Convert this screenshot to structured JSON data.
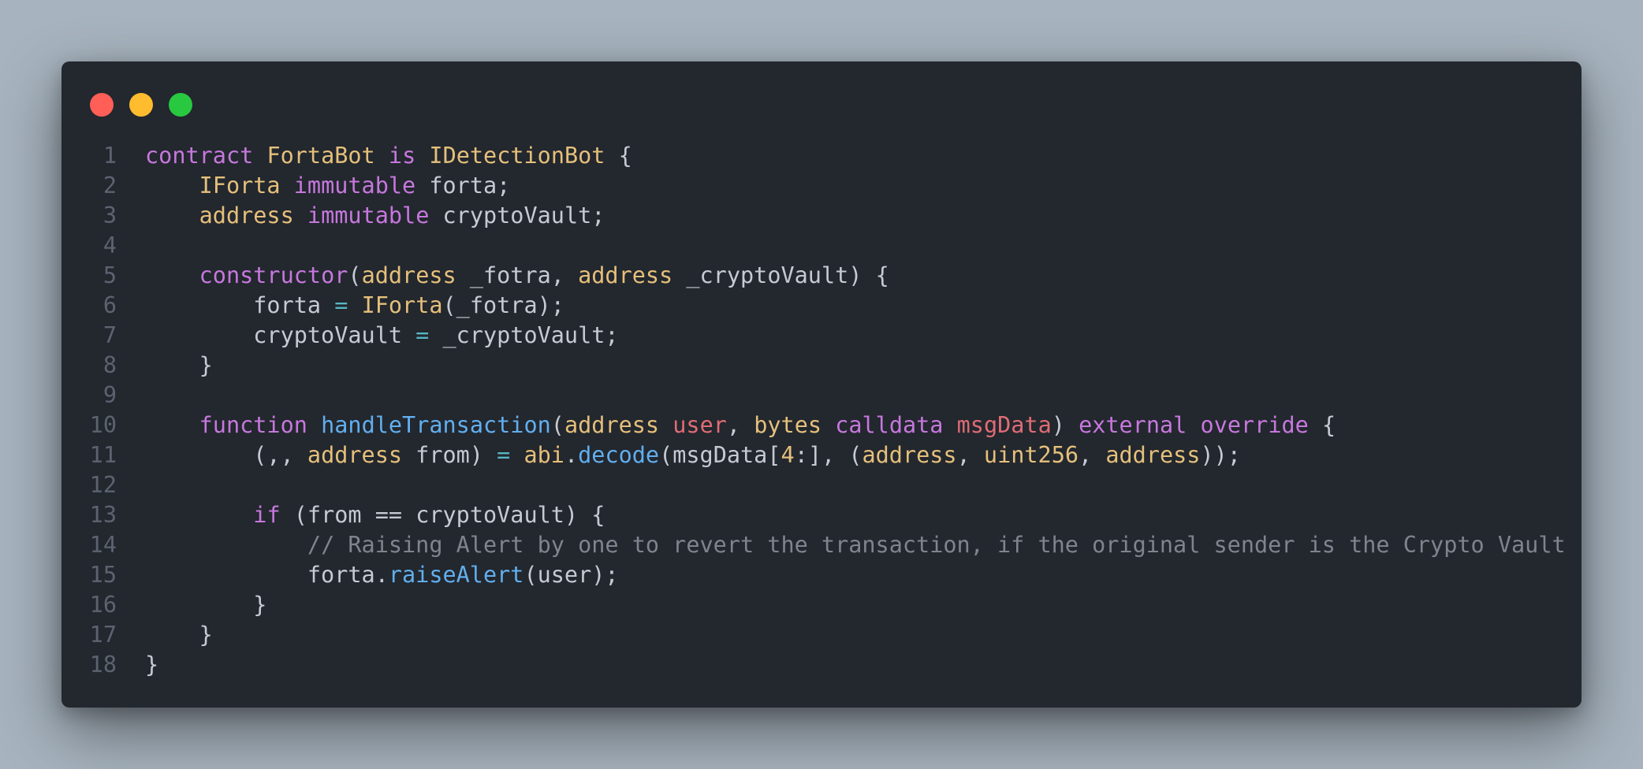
{
  "window": {
    "controls": {
      "close_color": "#ff5f57",
      "minimize_color": "#febc2e",
      "maximize_color": "#28c840"
    }
  },
  "code": {
    "lines": [
      {
        "n": "1",
        "tokens": [
          {
            "t": "contract",
            "c": "kw"
          },
          {
            "t": " ",
            "c": "pl"
          },
          {
            "t": "FortaBot",
            "c": "ty"
          },
          {
            "t": " ",
            "c": "pl"
          },
          {
            "t": "is",
            "c": "kw"
          },
          {
            "t": " ",
            "c": "pl"
          },
          {
            "t": "IDetectionBot",
            "c": "ty"
          },
          {
            "t": " {",
            "c": "pl"
          }
        ]
      },
      {
        "n": "2",
        "tokens": [
          {
            "t": "    ",
            "c": "pl"
          },
          {
            "t": "IForta",
            "c": "ty"
          },
          {
            "t": " ",
            "c": "pl"
          },
          {
            "t": "immutable",
            "c": "kw"
          },
          {
            "t": " forta;",
            "c": "pl"
          }
        ]
      },
      {
        "n": "3",
        "tokens": [
          {
            "t": "    ",
            "c": "pl"
          },
          {
            "t": "address",
            "c": "ty"
          },
          {
            "t": " ",
            "c": "pl"
          },
          {
            "t": "immutable",
            "c": "kw"
          },
          {
            "t": " cryptoVault;",
            "c": "pl"
          }
        ]
      },
      {
        "n": "4",
        "tokens": []
      },
      {
        "n": "5",
        "tokens": [
          {
            "t": "    ",
            "c": "pl"
          },
          {
            "t": "constructor",
            "c": "kw"
          },
          {
            "t": "(",
            "c": "pl"
          },
          {
            "t": "address",
            "c": "ty"
          },
          {
            "t": " _fotra, ",
            "c": "pl"
          },
          {
            "t": "address",
            "c": "ty"
          },
          {
            "t": " _cryptoVault) {",
            "c": "pl"
          }
        ]
      },
      {
        "n": "6",
        "tokens": [
          {
            "t": "        forta ",
            "c": "pl"
          },
          {
            "t": "=",
            "c": "op"
          },
          {
            "t": " ",
            "c": "pl"
          },
          {
            "t": "IForta",
            "c": "ty"
          },
          {
            "t": "(_fotra);",
            "c": "pl"
          }
        ]
      },
      {
        "n": "7",
        "tokens": [
          {
            "t": "        cryptoVault ",
            "c": "pl"
          },
          {
            "t": "=",
            "c": "op"
          },
          {
            "t": " _cryptoVault;",
            "c": "pl"
          }
        ]
      },
      {
        "n": "8",
        "tokens": [
          {
            "t": "    }",
            "c": "pl"
          }
        ]
      },
      {
        "n": "9",
        "tokens": []
      },
      {
        "n": "10",
        "tokens": [
          {
            "t": "    ",
            "c": "pl"
          },
          {
            "t": "function",
            "c": "kw"
          },
          {
            "t": " ",
            "c": "pl"
          },
          {
            "t": "handleTransaction",
            "c": "fn"
          },
          {
            "t": "(",
            "c": "pl"
          },
          {
            "t": "address",
            "c": "ty"
          },
          {
            "t": " ",
            "c": "pl"
          },
          {
            "t": "user",
            "c": "pm"
          },
          {
            "t": ", ",
            "c": "pl"
          },
          {
            "t": "bytes",
            "c": "ty"
          },
          {
            "t": " ",
            "c": "pl"
          },
          {
            "t": "calldata",
            "c": "kw"
          },
          {
            "t": " ",
            "c": "pl"
          },
          {
            "t": "msgData",
            "c": "pm"
          },
          {
            "t": ") ",
            "c": "pl"
          },
          {
            "t": "external",
            "c": "kw"
          },
          {
            "t": " ",
            "c": "pl"
          },
          {
            "t": "override",
            "c": "kw"
          },
          {
            "t": " {",
            "c": "pl"
          }
        ]
      },
      {
        "n": "11",
        "tokens": [
          {
            "t": "        (,, ",
            "c": "pl"
          },
          {
            "t": "address",
            "c": "ty"
          },
          {
            "t": " from) ",
            "c": "pl"
          },
          {
            "t": "=",
            "c": "op"
          },
          {
            "t": " ",
            "c": "pl"
          },
          {
            "t": "abi",
            "c": "ty"
          },
          {
            "t": ".",
            "c": "pl"
          },
          {
            "t": "decode",
            "c": "fn"
          },
          {
            "t": "(msgData[",
            "c": "pl"
          },
          {
            "t": "4",
            "c": "nu"
          },
          {
            "t": ":], (",
            "c": "pl"
          },
          {
            "t": "address",
            "c": "ty"
          },
          {
            "t": ", ",
            "c": "pl"
          },
          {
            "t": "uint256",
            "c": "ty"
          },
          {
            "t": ", ",
            "c": "pl"
          },
          {
            "t": "address",
            "c": "ty"
          },
          {
            "t": "));",
            "c": "pl"
          }
        ]
      },
      {
        "n": "12",
        "tokens": []
      },
      {
        "n": "13",
        "tokens": [
          {
            "t": "        ",
            "c": "pl"
          },
          {
            "t": "if",
            "c": "kw"
          },
          {
            "t": " (from == cryptoVault) {",
            "c": "pl"
          }
        ]
      },
      {
        "n": "14",
        "tokens": [
          {
            "t": "            ",
            "c": "pl"
          },
          {
            "t": "// Raising Alert by one to revert the transaction, if the original sender is the Crypto Vault",
            "c": "cm"
          }
        ]
      },
      {
        "n": "15",
        "tokens": [
          {
            "t": "            forta.",
            "c": "pl"
          },
          {
            "t": "raiseAlert",
            "c": "fn"
          },
          {
            "t": "(user);",
            "c": "pl"
          }
        ]
      },
      {
        "n": "16",
        "tokens": [
          {
            "t": "        }",
            "c": "pl"
          }
        ]
      },
      {
        "n": "17",
        "tokens": [
          {
            "t": "    }",
            "c": "pl"
          }
        ]
      },
      {
        "n": "18",
        "tokens": [
          {
            "t": "}",
            "c": "pl"
          }
        ]
      }
    ]
  }
}
